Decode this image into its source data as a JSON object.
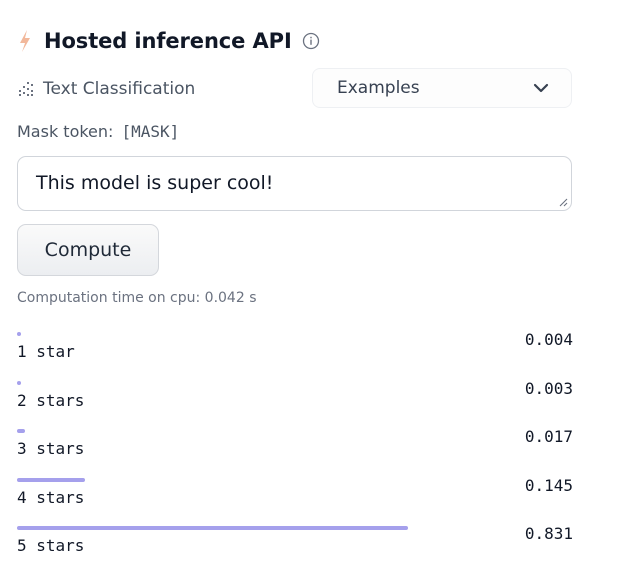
{
  "header": {
    "title": "Hosted inference API",
    "bolt_icon": "lightning-bolt-icon",
    "info_icon": "info-circle-icon",
    "bolt_color": "#f2b89b"
  },
  "task": {
    "icon": "text-classification-icon",
    "label": "Text Classification"
  },
  "examples_dropdown": {
    "label": "Examples",
    "icon": "chevron-down-icon"
  },
  "mask": {
    "label": "Mask token:",
    "token": "[MASK]"
  },
  "input": {
    "value": "This model is super cool!"
  },
  "compute": {
    "label": "Compute"
  },
  "computation_time": "Computation time on cpu: 0.042 s",
  "results": {
    "bar_color": "#a5a0ec",
    "items": [
      {
        "label": "1 star",
        "score": "0.004",
        "value": 0.004
      },
      {
        "label": "2 stars",
        "score": "0.003",
        "value": 0.003
      },
      {
        "label": "3 stars",
        "score": "0.017",
        "value": 0.017
      },
      {
        "label": "4 stars",
        "score": "0.145",
        "value": 0.145
      },
      {
        "label": "5 stars",
        "score": "0.831",
        "value": 0.831
      }
    ]
  }
}
